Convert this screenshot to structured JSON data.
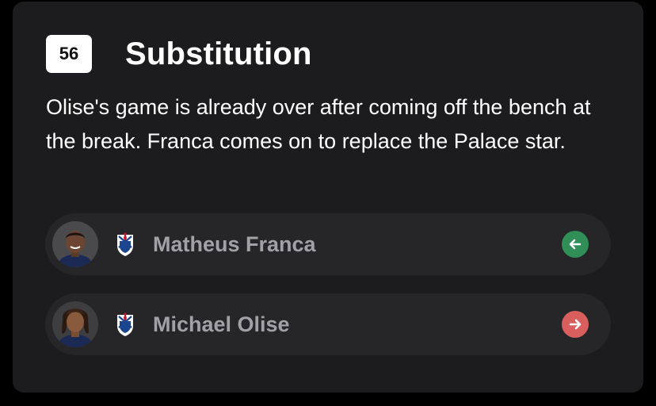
{
  "event": {
    "minute": "56",
    "title": "Substitution",
    "commentary": "Olise's game is already over after coming off the bench at the break. Franca comes on to replace the Palace star."
  },
  "players": [
    {
      "name": "Matheus Franca",
      "club_icon": "crystal-palace-crest",
      "direction": "in",
      "direction_icon": "arrow-left-icon",
      "direction_color": "#2f8f57"
    },
    {
      "name": "Michael Olise",
      "club_icon": "crystal-palace-crest",
      "direction": "out",
      "direction_icon": "arrow-right-icon",
      "direction_color": "#d95f5f"
    }
  ],
  "colors": {
    "card_bg": "#1c1c1e",
    "row_bg": "#262628",
    "badge_bg": "#ffffff",
    "text_primary": "#ffffff",
    "text_secondary": "#a1a1a6"
  }
}
